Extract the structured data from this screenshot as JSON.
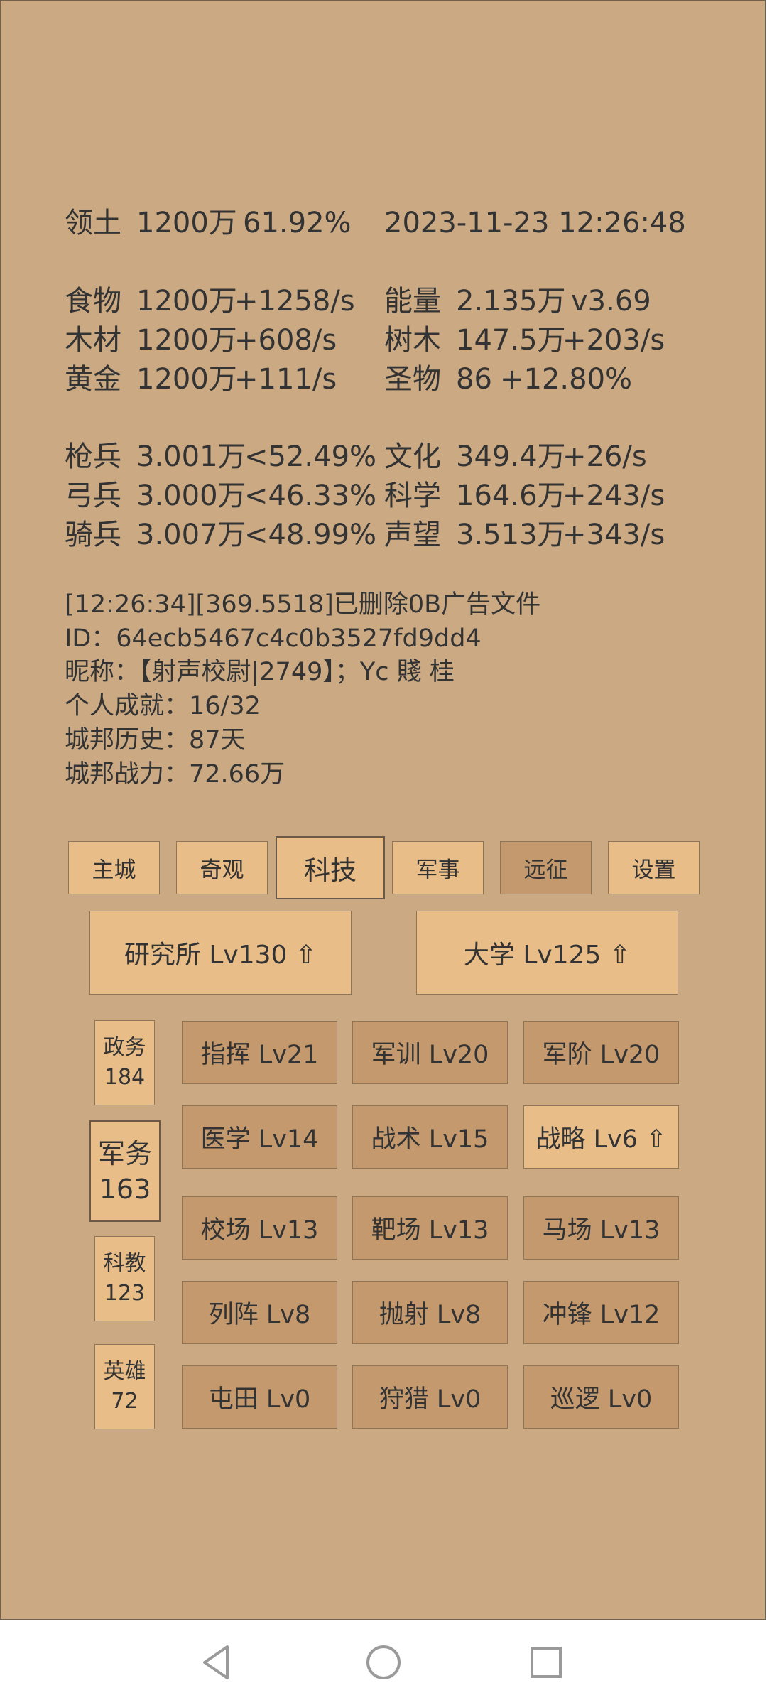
{
  "status": {
    "territory": {
      "label": "领土",
      "value": "1200万",
      "pct": "61.92%"
    },
    "datetime": "2023-11-23 12:26:48",
    "left_resources": [
      {
        "label": "食物",
        "value": "1200万",
        "rate": "+1258/s"
      },
      {
        "label": "木材",
        "value": "1200万",
        "rate": "+608/s"
      },
      {
        "label": "黄金",
        "value": "1200万",
        "rate": "+111/s"
      }
    ],
    "right_resources": [
      {
        "label": "能量",
        "value": "2.135万",
        "rate": "v3.69"
      },
      {
        "label": "树木",
        "value": "147.5万",
        "rate": "+203/s"
      },
      {
        "label": "圣物",
        "value": "86",
        "rate": "+12.80%"
      }
    ],
    "left_troops": [
      {
        "label": "枪兵",
        "value": "3.001万",
        "rate": "<52.49%"
      },
      {
        "label": "弓兵",
        "value": "3.000万",
        "rate": "<46.33%"
      },
      {
        "label": "骑兵",
        "value": "3.007万",
        "rate": "<48.99%"
      }
    ],
    "right_stats": [
      {
        "label": "文化",
        "value": "349.4万",
        "rate": "+26/s"
      },
      {
        "label": "科学",
        "value": "164.6万",
        "rate": "+243/s"
      },
      {
        "label": "声望",
        "value": "3.513万",
        "rate": "+343/s"
      }
    ]
  },
  "info": [
    "[12:26:34][369.5518]已删除0B广告文件",
    "ID：64ecb5467c4c0b3527fd9dd4",
    "昵称：【射声校尉|2749】；Yc  賤 桂",
    "个人成就：16/32",
    "城邦历史：87天",
    "城邦战力：72.66万"
  ],
  "tabs": [
    "主城",
    "奇观",
    "科技",
    "军事",
    "远征",
    "设置"
  ],
  "active_tab": "科技",
  "buildings": [
    {
      "label": "研究所 Lv130 ⇧"
    },
    {
      "label": "大学 Lv125 ⇧"
    }
  ],
  "categories": [
    {
      "name": "政务",
      "count": "184"
    },
    {
      "name": "军务",
      "count": "163"
    },
    {
      "name": "科教",
      "count": "123"
    },
    {
      "name": "英雄",
      "count": "72"
    }
  ],
  "techs": [
    [
      "指挥 Lv21",
      "军训 Lv20",
      "军阶 Lv20"
    ],
    [
      "医学 Lv14",
      "战术 Lv15",
      "战略 Lv6 ⇧"
    ],
    [
      "校场 Lv13",
      "靶场 Lv13",
      "马场 Lv13"
    ],
    [
      "列阵 Lv8",
      "抛射 Lv8",
      "冲锋 Lv12"
    ],
    [
      "屯田 Lv0",
      "狩猎 Lv0",
      "巡逻 Lv0"
    ]
  ],
  "nav_icons": [
    "back-triangle-icon",
    "home-circle-icon",
    "recents-square-icon"
  ]
}
